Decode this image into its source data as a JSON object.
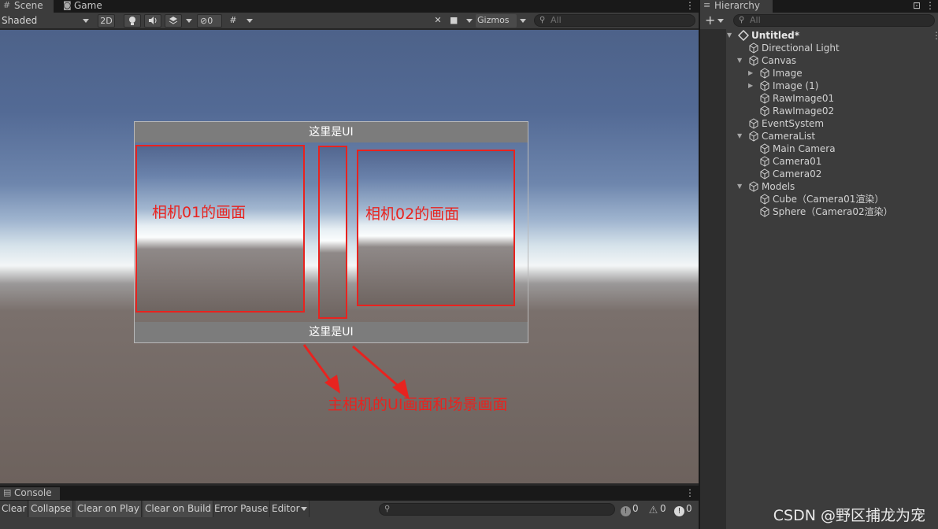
{
  "scene": {
    "tabs": [
      {
        "label": "Scene",
        "icon": "hash-icon"
      },
      {
        "label": "Game",
        "icon": "gamepad-icon"
      }
    ],
    "toolbar": {
      "shading_mode": "Shaded",
      "mode_2d_label": "2D",
      "hidden_count": "0",
      "gizmos_label": "Gizmos",
      "search_placeholder": "All"
    },
    "viewport": {
      "ui_top_label": "这里是UI",
      "ui_bottom_label": "这里是UI",
      "annotation_camera01": "相机01的画面",
      "annotation_camera02": "相机02的画面",
      "annotation_main": "主相机的UI画面和场景画面",
      "annotation_color": "#e8231f"
    }
  },
  "console": {
    "tab_label": "Console",
    "buttons": [
      "Clear",
      "Collapse",
      "Clear on Play",
      "Clear on Build",
      "Error Pause",
      "Editor"
    ],
    "log_count": "0",
    "warning_count": "0",
    "error_count": "0"
  },
  "hierarchy": {
    "tab_label": "Hierarchy",
    "search_placeholder": "All",
    "root": "Untitled*",
    "items": [
      {
        "label": "Directional Light"
      },
      {
        "label": "Canvas"
      },
      {
        "label": "Image"
      },
      {
        "label": "Image (1)"
      },
      {
        "label": "RawImage01"
      },
      {
        "label": "RawImage02"
      },
      {
        "label": "EventSystem"
      },
      {
        "label": "CameraList"
      },
      {
        "label": "Main Camera"
      },
      {
        "label": "Camera01"
      },
      {
        "label": "Camera02"
      },
      {
        "label": "Models"
      },
      {
        "label": "Cube（Camera01渲染）"
      },
      {
        "label": "Sphere（Camera02渲染）"
      }
    ]
  },
  "watermark": "CSDN @野区捕龙为宠"
}
